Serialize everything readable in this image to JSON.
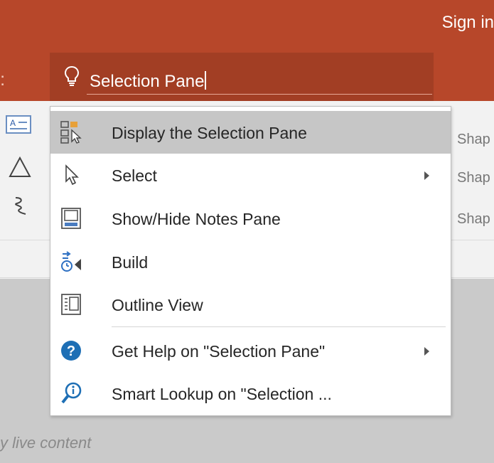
{
  "titlebar": {
    "sign_in": "Sign in"
  },
  "tell_me": {
    "query": "Selection Pane"
  },
  "ribbon": {
    "shape_label": "Shap"
  },
  "menu": {
    "items": [
      {
        "label": "Display the Selection Pane",
        "icon": "selection-pane-icon",
        "submenu": false,
        "highlighted": true
      },
      {
        "label": "Select",
        "icon": "cursor-arrow-icon",
        "submenu": true,
        "highlighted": false
      },
      {
        "label": "Show/Hide Notes Pane",
        "icon": "notes-pane-icon",
        "submenu": false,
        "highlighted": false
      },
      {
        "label": "Build",
        "icon": "build-animation-icon",
        "submenu": false,
        "highlighted": false
      },
      {
        "label": "Outline View",
        "icon": "outline-view-icon",
        "submenu": false,
        "highlighted": false
      },
      {
        "label": "Get Help on \"Selection Pane\"",
        "icon": "help-icon",
        "submenu": true,
        "highlighted": false
      },
      {
        "label": "Smart Lookup on \"Selection ...",
        "icon": "smart-lookup-icon",
        "submenu": false,
        "highlighted": false
      }
    ]
  },
  "slide": {
    "placeholder_fragment": "y live content"
  },
  "colors": {
    "accent": "#b7472a",
    "tell_me_bg": "#a23e24",
    "highlight": "#c6c6c6",
    "help_blue": "#1e6fb5"
  }
}
